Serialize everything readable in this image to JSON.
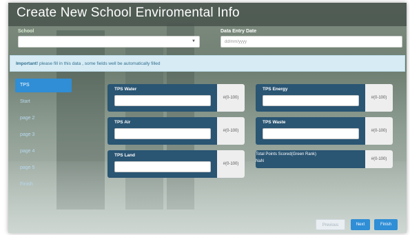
{
  "window": {
    "title": "Create New School Enviromental Info"
  },
  "form": {
    "school_label": "School",
    "school_value": "",
    "date_label": "Data Entry Date",
    "date_placeholder": "dd/mm/yyyy"
  },
  "alert": {
    "bold": "Important!",
    "text": " please fill in this data , some fields well be automatically filled"
  },
  "nav": {
    "items": [
      "TPS",
      "Start",
      "page 2",
      "page 3",
      "page 4",
      "page 5",
      "Finish"
    ],
    "active_index": 0
  },
  "cards": {
    "water": {
      "label": "TPS Water",
      "addon": "#(0-100)"
    },
    "energy": {
      "label": "TPS Energy",
      "addon": "#(0-100)"
    },
    "air": {
      "label": "TPS Air",
      "addon": "#(0-100)"
    },
    "waste": {
      "label": "TPS Waste",
      "addon": "#(0-100)"
    },
    "land": {
      "label": "TPS Land",
      "addon": "#(0-100)"
    },
    "total": {
      "label": "Total Points Scored(Green Rank)",
      "value": "NaN",
      "addon": "#(0-100)"
    }
  },
  "buttons": {
    "previous": "Previous",
    "next": "Next",
    "finish": "Finish"
  },
  "colors": {
    "primary": "#2f8ed6",
    "card": "#2a5573",
    "alert_bg": "#d6ebf4",
    "alert_text": "#31708f"
  },
  "icons": {
    "select_caret": "caret-down-icon"
  }
}
